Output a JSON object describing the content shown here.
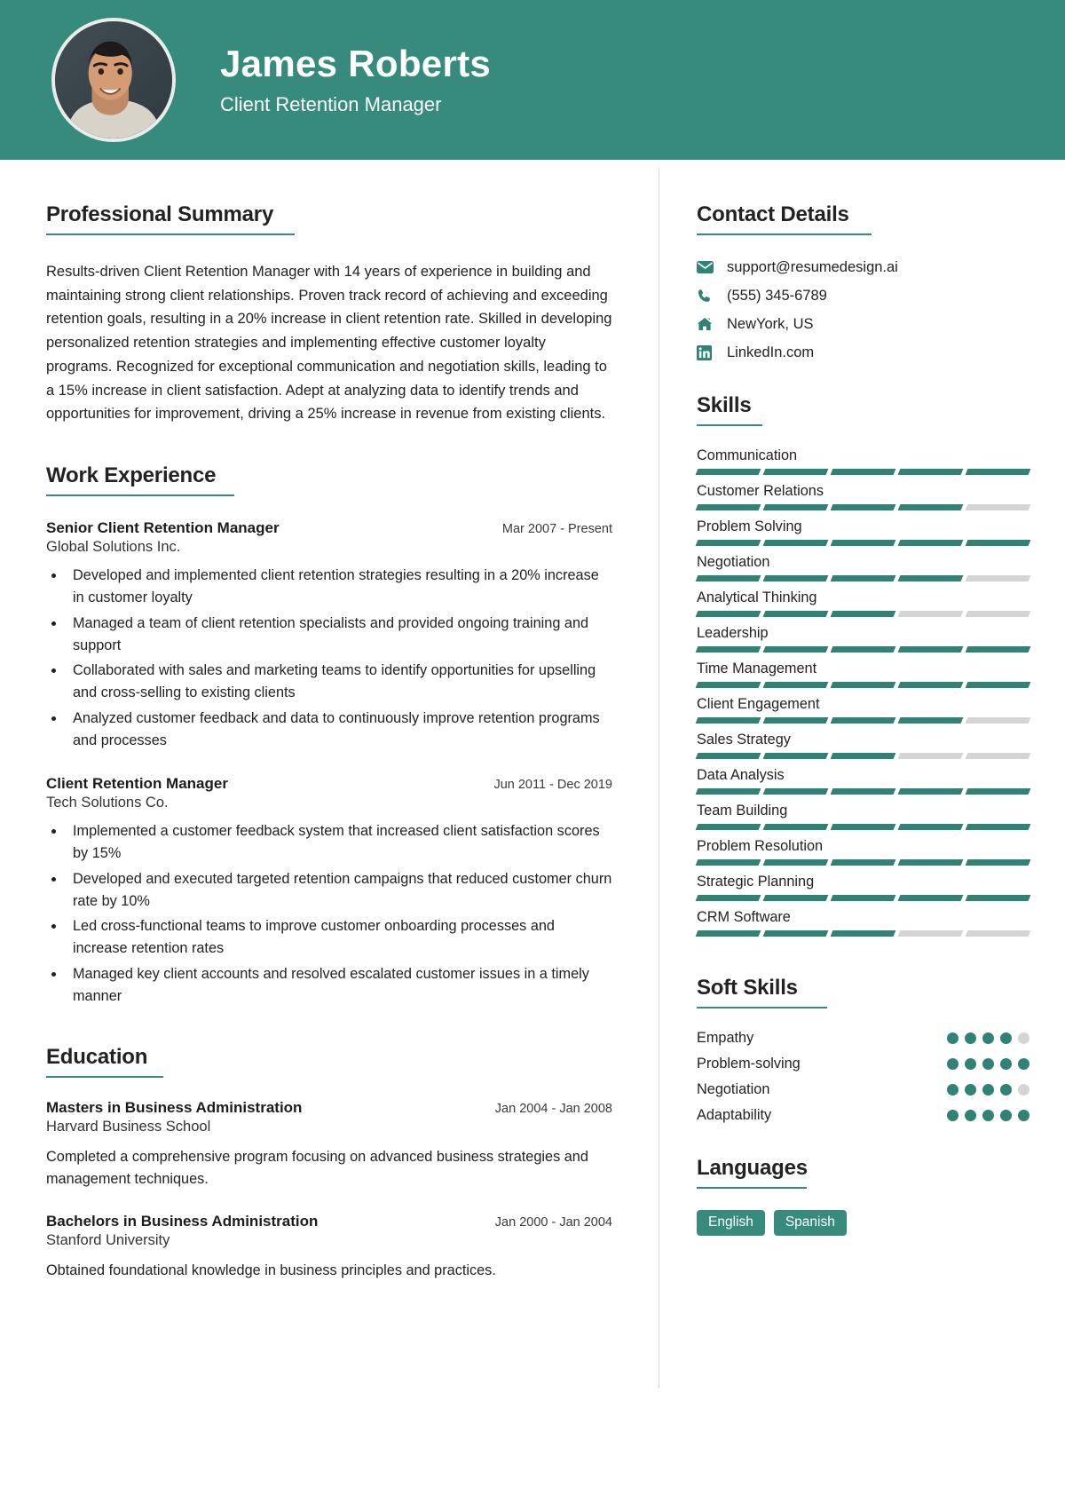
{
  "header": {
    "name": "James Roberts",
    "role": "Client Retention Manager",
    "avatar_icon": "user-photo",
    "bg_color": "#368b7d"
  },
  "theme": {
    "accent": "#368b7d",
    "accent_dark": "#2f8274",
    "muted": "#d5d5d5"
  },
  "left": {
    "summary_heading": "Professional Summary",
    "summary_text": "Results-driven Client Retention Manager with 14 years of experience in building and maintaining strong client relationships. Proven track record of achieving and exceeding retention goals, resulting in a 20% increase in client retention rate. Skilled in developing personalized retention strategies and implementing effective customer loyalty programs. Recognized for exceptional communication and negotiation skills, leading to a 15% increase in client satisfaction. Adept at analyzing data to identify trends and opportunities for improvement, driving a 25% increase in revenue from existing clients.",
    "work_heading": "Work Experience",
    "jobs": [
      {
        "title": "Senior Client Retention Manager",
        "date": "Mar 2007 - Present",
        "company": "Global Solutions Inc.",
        "bullets": [
          "Developed and implemented client retention strategies resulting in a 20% increase in customer loyalty",
          "Managed a team of client retention specialists and provided ongoing training and support",
          "Collaborated with sales and marketing teams to identify opportunities for upselling and cross-selling to existing clients",
          "Analyzed customer feedback and data to continuously improve retention programs and processes"
        ]
      },
      {
        "title": "Client Retention Manager",
        "date": "Jun 2011 - Dec 2019",
        "company": "Tech Solutions Co.",
        "bullets": [
          "Implemented a customer feedback system that increased client satisfaction scores by 15%",
          "Developed and executed targeted retention campaigns that reduced customer churn rate by 10%",
          "Led cross-functional teams to improve customer onboarding processes and increase retention rates",
          "Managed key client accounts and resolved escalated customer issues in a timely manner"
        ]
      }
    ],
    "education_heading": "Education",
    "education": [
      {
        "degree": "Masters in Business Administration",
        "date": "Jan 2004 - Jan 2008",
        "school": "Harvard Business School",
        "description": "Completed a comprehensive program focusing on advanced business strategies and management techniques."
      },
      {
        "degree": "Bachelors in Business Administration",
        "date": "Jan 2000 - Jan 2004",
        "school": "Stanford University",
        "description": "Obtained foundational knowledge in business principles and practices."
      }
    ]
  },
  "right": {
    "contact_heading": "Contact Details",
    "contacts": [
      {
        "icon": "envelope-icon",
        "value": "support@resumedesign.ai"
      },
      {
        "icon": "phone-icon",
        "value": "(555) 345-6789"
      },
      {
        "icon": "home-icon",
        "value": "NewYork, US"
      },
      {
        "icon": "linkedin-icon",
        "value": "LinkedIn.com"
      }
    ],
    "skills_heading": "Skills",
    "skills": [
      {
        "name": "Communication",
        "level": 5,
        "max": 5
      },
      {
        "name": "Customer Relations",
        "level": 4,
        "max": 5
      },
      {
        "name": "Problem Solving",
        "level": 5,
        "max": 5
      },
      {
        "name": "Negotiation",
        "level": 4,
        "max": 5
      },
      {
        "name": "Analytical Thinking",
        "level": 3,
        "max": 5
      },
      {
        "name": "Leadership",
        "level": 5,
        "max": 5
      },
      {
        "name": "Time Management",
        "level": 5,
        "max": 5
      },
      {
        "name": "Client Engagement",
        "level": 4,
        "max": 5
      },
      {
        "name": "Sales Strategy",
        "level": 3,
        "max": 5
      },
      {
        "name": "Data Analysis",
        "level": 5,
        "max": 5
      },
      {
        "name": "Team Building",
        "level": 5,
        "max": 5
      },
      {
        "name": "Problem Resolution",
        "level": 5,
        "max": 5
      },
      {
        "name": "Strategic Planning",
        "level": 5,
        "max": 5
      },
      {
        "name": "CRM Software",
        "level": 3,
        "max": 5
      }
    ],
    "soft_skills_heading": "Soft Skills",
    "soft_skills": [
      {
        "name": "Empathy",
        "level": 4,
        "max": 5
      },
      {
        "name": "Problem-solving",
        "level": 5,
        "max": 5
      },
      {
        "name": "Negotiation",
        "level": 4,
        "max": 5
      },
      {
        "name": "Adaptability",
        "level": 5,
        "max": 5
      }
    ],
    "languages_heading": "Languages",
    "languages": [
      "English",
      "Spanish"
    ]
  }
}
